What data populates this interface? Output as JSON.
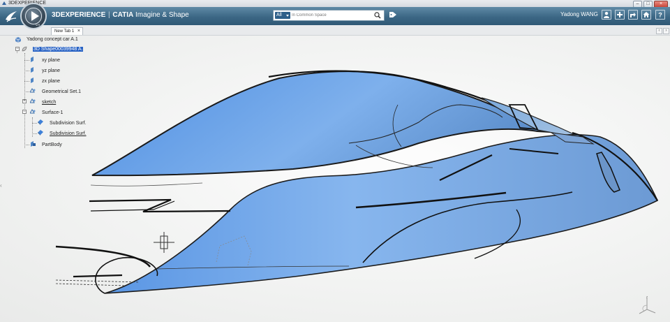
{
  "window": {
    "title": "3DEXPERIENCE"
  },
  "header": {
    "brand": "3DEXPERIENCE",
    "separator": "|",
    "app_name": "CATIA",
    "app_module": "Imagine & Shape",
    "compass_label": "V.R",
    "search": {
      "scope": "All",
      "placeholder": "In Common Space"
    },
    "user_name": "Yadong WANG"
  },
  "tabs": [
    {
      "label": "New Tab 1",
      "close": "×"
    }
  ],
  "tab_nav": {
    "prev": "‹",
    "next": "›"
  },
  "tree": {
    "root": "Yadong concept car A.1",
    "shape": "3D Shape00039948 A.",
    "nodes": [
      {
        "label": "xy plane",
        "icon": "plane-icon"
      },
      {
        "label": "yz plane",
        "icon": "plane-icon"
      },
      {
        "label": "zx plane",
        "icon": "plane-icon"
      },
      {
        "label": "Geometrical Set.1",
        "icon": "geometrical-set-icon"
      },
      {
        "label": "sketch",
        "icon": "sketch-icon"
      },
      {
        "label": "Surface-1",
        "icon": "geometrical-set-icon"
      },
      {
        "label": "Subdivision Surf.",
        "icon": "subdivision-surface-icon"
      },
      {
        "label": "Subdivision Surf.",
        "icon": "subdivision-surface-icon"
      },
      {
        "label": "PartBody",
        "icon": "part-body-icon"
      }
    ]
  },
  "viewport": {
    "axis_label": "z"
  },
  "colors": {
    "header": "#3c6785",
    "surface": "#6a9fe0",
    "selection": "#2a64c5"
  }
}
